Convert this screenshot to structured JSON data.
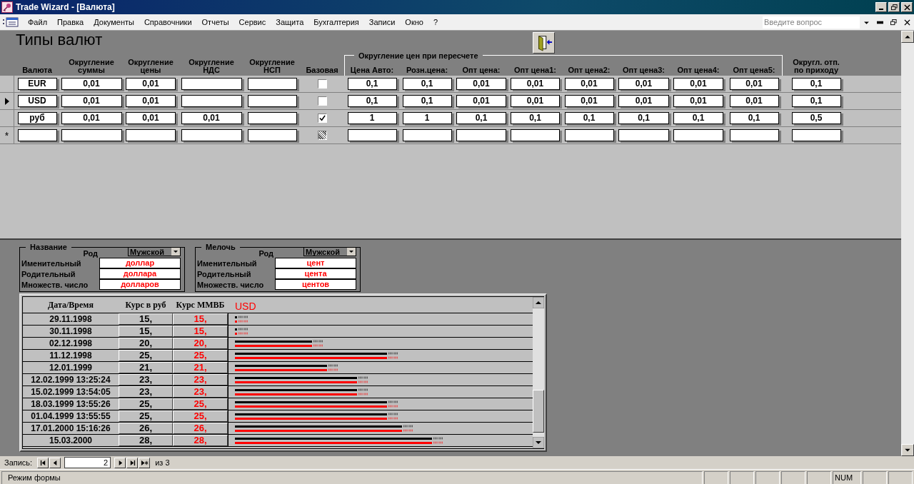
{
  "window": {
    "title": "Trade Wizard - [Валюта]"
  },
  "menu": [
    "Файл",
    "Правка",
    "Документы",
    "Справочники",
    "Отчеты",
    "Сервис",
    "Защита",
    "Бухгалтерия",
    "Записи",
    "Окно",
    "?"
  ],
  "help_search": {
    "placeholder": "Введите вопрос"
  },
  "form": {
    "title": "Типы валют",
    "columns": [
      {
        "lines": [
          "Валюта"
        ]
      },
      {
        "lines": [
          "Округление",
          "суммы"
        ]
      },
      {
        "lines": [
          "Округление",
          "цены"
        ]
      },
      {
        "lines": [
          "Округление",
          "НДС"
        ]
      },
      {
        "lines": [
          "Округление",
          "НСП"
        ]
      },
      {
        "lines": [
          "Базовая"
        ]
      }
    ],
    "price_group": {
      "label": "Округление цен при пересчете",
      "columns": [
        {
          "lines": [
            "Цена Авто:"
          ]
        },
        {
          "lines": [
            "Розн.цена:"
          ]
        },
        {
          "lines": [
            "Опт цена:"
          ]
        },
        {
          "lines": [
            "Опт цена1:"
          ]
        },
        {
          "lines": [
            "Опт цена2:"
          ]
        },
        {
          "lines": [
            "Опт цена3:"
          ]
        },
        {
          "lines": [
            "Опт цена4:"
          ]
        },
        {
          "lines": [
            "Опт цена5:"
          ]
        }
      ]
    },
    "tail_columns": [
      {
        "lines": [
          "Округл. отп.",
          "по приходу"
        ]
      }
    ],
    "rows": [
      {
        "kind": "record",
        "selected": false,
        "base": false,
        "cells": [
          "EUR",
          "0,01",
          "0,01",
          null,
          null,
          "0,1",
          "0,1",
          "0,01",
          "0,01",
          "0,01",
          "0,01",
          "0,01",
          "0,01",
          "0,1"
        ]
      },
      {
        "kind": "record",
        "selected": true,
        "base": false,
        "cells": [
          "USD",
          "0,01",
          "0,01",
          null,
          null,
          "0,1",
          "0,1",
          "0,01",
          "0,01",
          "0,01",
          "0,01",
          "0,01",
          "0,01",
          "0,1"
        ]
      },
      {
        "kind": "record",
        "selected": false,
        "base": true,
        "cells": [
          "руб",
          "0,01",
          "0,01",
          "0,01",
          null,
          "1",
          "1",
          "0,1",
          "0,1",
          "0,1",
          "0,1",
          "0,1",
          "0,1",
          "0,5"
        ]
      },
      {
        "kind": "new",
        "selected": false,
        "marker": "*"
      }
    ]
  },
  "naming": [
    {
      "title": "Название",
      "gender_label": "Род",
      "gender": "Мужской",
      "cases": [
        {
          "label": "Именительный",
          "value": "доллар"
        },
        {
          "label": "Родительный",
          "value": "доллара"
        },
        {
          "label": "Множеств. число",
          "value": "долларов"
        }
      ]
    },
    {
      "title": "Мелочь",
      "gender_label": "Род",
      "gender": "Мужской",
      "cases": [
        {
          "label": "Именительный",
          "value": "цент"
        },
        {
          "label": "Родительный",
          "value": "цента"
        },
        {
          "label": "Множеств. число",
          "value": "центов"
        }
      ]
    }
  ],
  "history": {
    "columns": [
      "Дата/Время",
      "Курс в руб",
      "Курс ММВБ"
    ],
    "chart_label": "USD",
    "rows": [
      {
        "date": "29.11.1998",
        "rate": "15,",
        "mmvb": "15,"
      },
      {
        "date": "30.11.1998",
        "rate": "15,",
        "mmvb": "15,"
      },
      {
        "date": "02.12.1998",
        "rate": "20,",
        "mmvb": "20,"
      },
      {
        "date": "11.12.1998",
        "rate": "25,",
        "mmvb": "25,"
      },
      {
        "date": "12.01.1999",
        "rate": "21,",
        "mmvb": "21,"
      },
      {
        "date": "12.02.1999 13:25:24",
        "rate": "23,",
        "mmvb": "23,"
      },
      {
        "date": "15.02.1999 13:54:05",
        "rate": "23,",
        "mmvb": "23,"
      },
      {
        "date": "18.03.1999 13:55:26",
        "rate": "25,",
        "mmvb": "25,"
      },
      {
        "date": "01.04.1999 13:55:55",
        "rate": "25,",
        "mmvb": "25,"
      },
      {
        "date": "17.01.2000 15:16:26",
        "rate": "26,",
        "mmvb": "26,"
      },
      {
        "date": "15.03.2000",
        "rate": "28,",
        "mmvb": "28,"
      }
    ]
  },
  "navigator": {
    "label": "Запись:",
    "current": "2",
    "total": "из 3"
  },
  "status": {
    "text": "Режим формы",
    "indicator": "NUM"
  }
}
